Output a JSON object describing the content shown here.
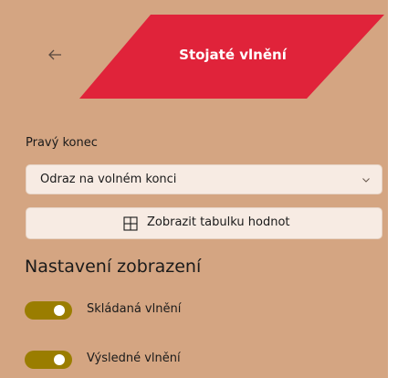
{
  "header": {
    "title": "Stojaté vlnění",
    "back_icon": "arrow-left-icon",
    "accent_color": "#e0233a"
  },
  "right_end": {
    "label": "Pravý konec",
    "selected_value": "Odraz na volném konci",
    "chevron_icon": "chevron-down-icon"
  },
  "table_button": {
    "icon": "table-grid-icon",
    "label": "Zobrazit tabulku hodnot"
  },
  "display_settings": {
    "title": "Nastavení zobrazení",
    "toggles": [
      {
        "label": "Skládaná vlnění",
        "on": true
      },
      {
        "label": "Výsledné vlnění",
        "on": true
      }
    ],
    "toggle_color": "#9a7d00"
  },
  "theme": {
    "panel_background": "#d4a582",
    "control_background": "#f7ebe3"
  }
}
